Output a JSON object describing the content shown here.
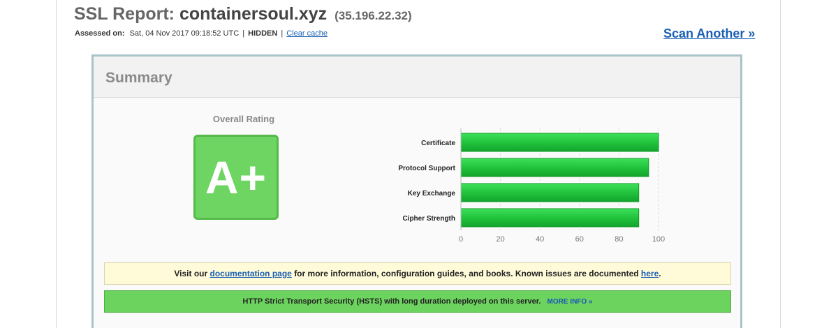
{
  "header": {
    "title_prefix": "SSL Report:",
    "hostname": "containersoul.xyz",
    "ip": "(35.196.22.32)",
    "assessed_label": "Assessed on:",
    "assessed_date": "Sat, 04 Nov 2017 09:18:52 UTC",
    "separator": "|",
    "hidden_flag": "HIDDEN",
    "clear_cache_link": "Clear cache",
    "scan_another_link": "Scan Another »"
  },
  "summary": {
    "title": "Summary",
    "overall_rating_label": "Overall Rating",
    "grade": "A+",
    "grade_color": "#6ed563"
  },
  "chart_data": {
    "type": "bar",
    "orientation": "horizontal",
    "categories": [
      "Certificate",
      "Protocol Support",
      "Key Exchange",
      "Cipher Strength"
    ],
    "values": [
      100,
      95,
      90,
      90
    ],
    "xlim": [
      0,
      100
    ],
    "xticks": [
      0,
      20,
      40,
      60,
      80,
      100
    ],
    "grid": true,
    "bar_color": "#22c33c",
    "title": "",
    "xlabel": "",
    "ylabel": ""
  },
  "notices": {
    "doc_text_before": "Visit our",
    "doc_link": "documentation page",
    "doc_text_after": "for more information, configuration guides, and books. Known issues are documented",
    "doc_here_link": "here",
    "doc_period": ".",
    "hsts_text": "HTTP Strict Transport Security (HSTS) with long duration deployed on this server.",
    "hsts_link": "MORE INFO »"
  }
}
